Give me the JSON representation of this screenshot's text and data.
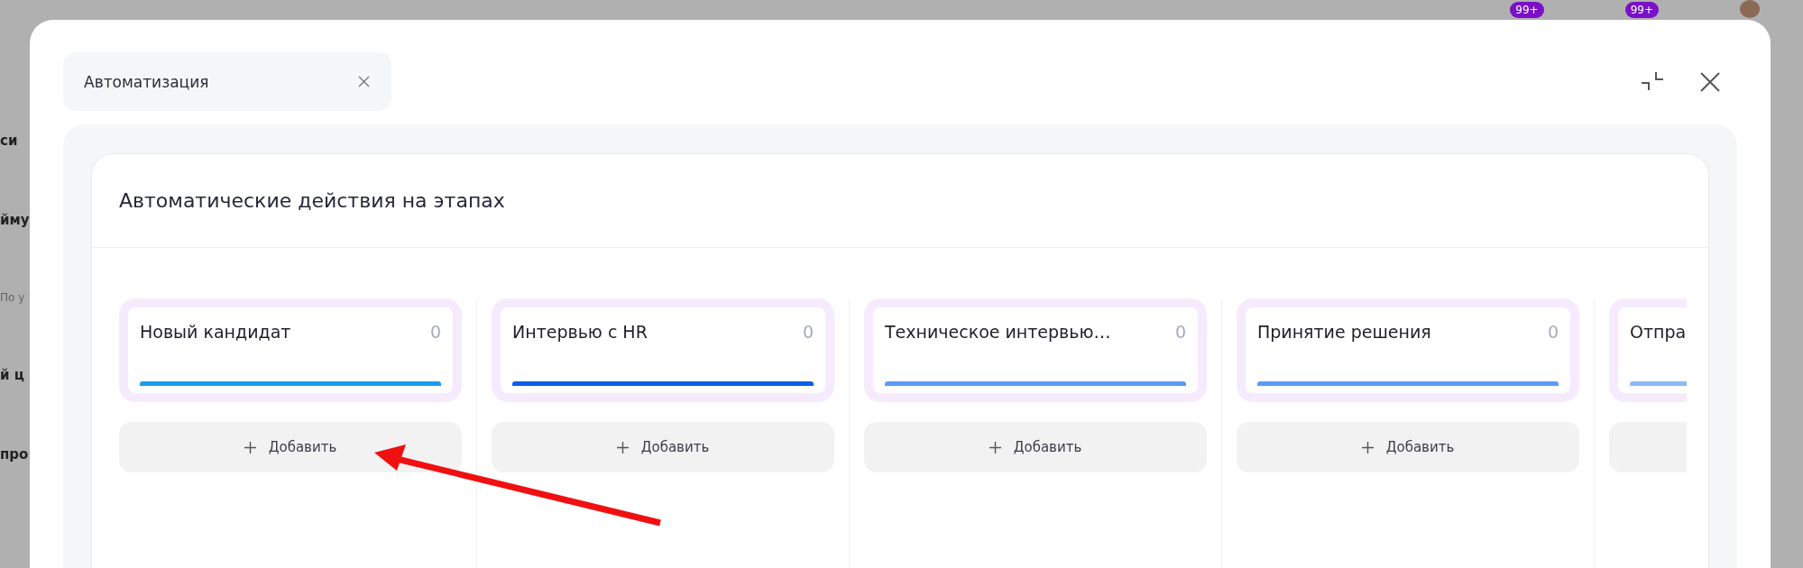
{
  "background": {
    "fragments": [
      "си",
      "йму",
      "По у",
      "й ц",
      "про"
    ],
    "badges": [
      "99+",
      "99+"
    ]
  },
  "tab": {
    "label": "Автоматизация"
  },
  "card": {
    "title": "Автоматические действия на этапах"
  },
  "stages": [
    {
      "title": "Новый кандидат",
      "count": "0",
      "color": "#1a9bef",
      "add_label": "Добавить"
    },
    {
      "title": "Интервью с HR",
      "count": "0",
      "color": "#0a5fe8",
      "add_label": "Добавить"
    },
    {
      "title": "Техническое интервью…",
      "count": "0",
      "color": "#5b9bf8",
      "add_label": "Добавить"
    },
    {
      "title": "Принятие решения",
      "count": "0",
      "color": "#5b9bf8",
      "add_label": "Добавить"
    },
    {
      "title": "Отпра",
      "color": "#8db8f9"
    }
  ]
}
